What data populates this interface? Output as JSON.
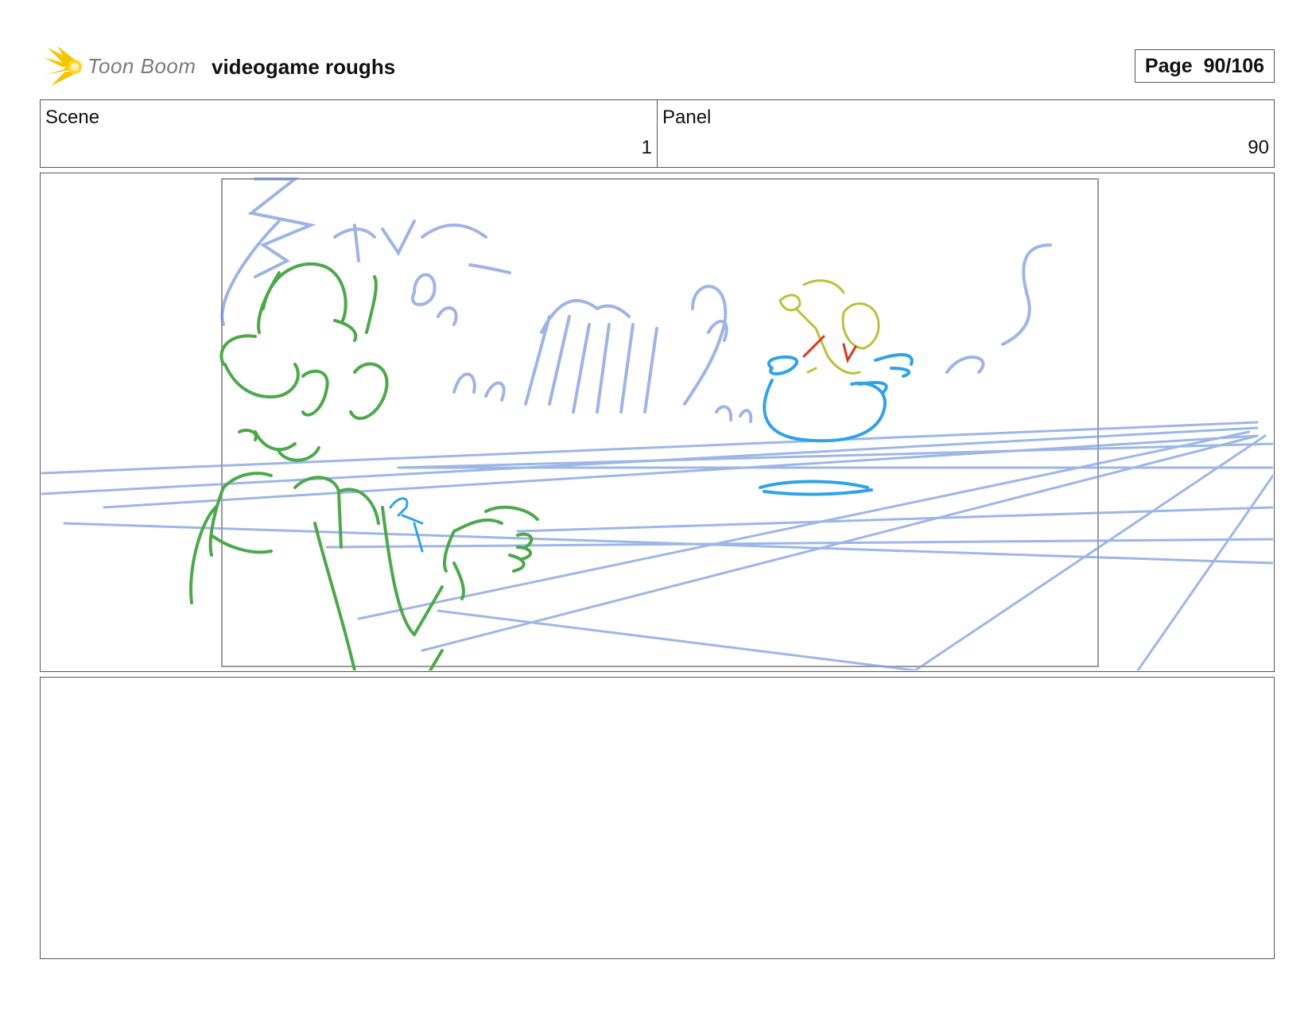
{
  "header": {
    "brand_name": "Toon Boom",
    "project_title": "videogame roughs",
    "page_label": "Page",
    "page_number": "90/106",
    "logo_icon": "starburst-logo-icon"
  },
  "info": {
    "scene_label": "Scene",
    "scene_value": "1",
    "panel_label": "Panel",
    "panel_value": "90"
  },
  "colors": {
    "perspective_lines": "#7d9ee0",
    "background_sketch": "#5f83d4",
    "foreground_character": "#4ca84a",
    "vehicle_sketch": "#2ea3e6",
    "rider_sketch": "#b7c23a",
    "rider_accent": "#d9361e",
    "logo": "#f5c400"
  }
}
